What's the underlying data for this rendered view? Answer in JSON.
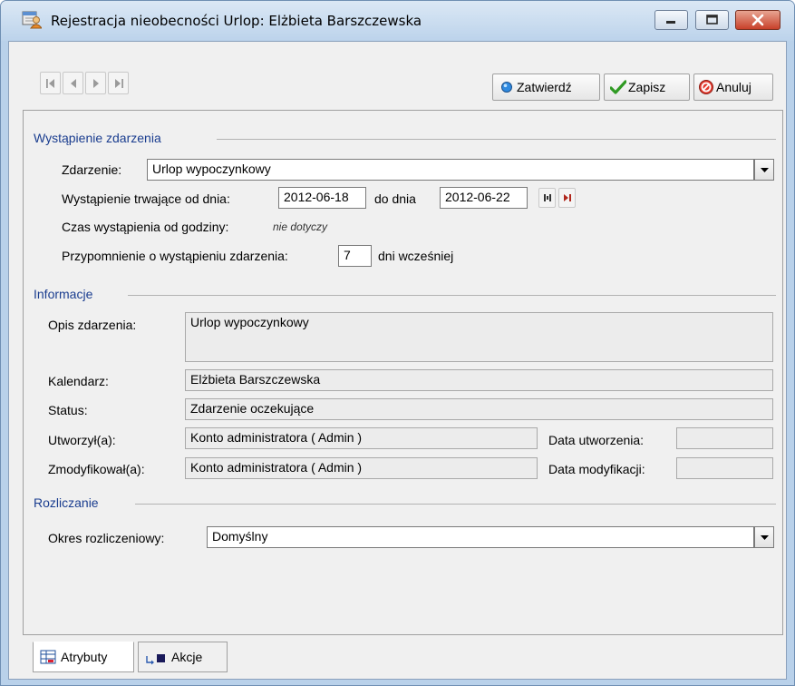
{
  "window": {
    "title": "Rejestracja nieobecności Urlop:  Elżbieta Barszczewska",
    "minimize_icon": "minimize-icon",
    "maximize_icon": "maximize-icon",
    "close_icon": "close-icon"
  },
  "toolbar": {
    "nav_icons": [
      "first-record-icon",
      "previous-record-icon",
      "next-record-icon",
      "last-record-icon"
    ],
    "approve_label": "Zatwierdź",
    "save_label": "Zapisz",
    "cancel_label": "Anuluj"
  },
  "occurrence": {
    "section_title": "Wystąpienie zdarzenia",
    "event_label": "Zdarzenie:",
    "event_value": "Urlop wypoczynkowy",
    "from_label": "Wystąpienie trwające od dnia:",
    "from_value": "2012-06-18",
    "to_label": "do dnia",
    "to_value": "2012-06-22",
    "time_label": "Czas wystąpienia od godziny:",
    "time_value": "nie dotyczy",
    "reminder_label": "Przypomnienie o wystąpieniu zdarzenia:",
    "reminder_value": "7",
    "reminder_suffix": "dni wcześniej"
  },
  "info": {
    "section_title": "Informacje",
    "desc_label": "Opis zdarzenia:",
    "desc_value": "Urlop wypoczynkowy",
    "calendar_label": "Kalendarz:",
    "calendar_value": "Elżbieta Barszczewska",
    "status_label": "Status:",
    "status_value": "Zdarzenie oczekujące",
    "created_by_label": "Utworzył(a):",
    "created_by_value": "Konto administratora ( Admin )",
    "created_date_label": "Data utworzenia:",
    "created_date_value": "",
    "modified_by_label": "Zmodyfikował(a):",
    "modified_by_value": "Konto administratora ( Admin )",
    "modified_date_label": "Data modyfikacji:",
    "modified_date_value": ""
  },
  "settlement": {
    "section_title": "Rozliczanie",
    "period_label": "Okres rozliczeniowy:",
    "period_value": "Domyślny"
  },
  "tabs": {
    "attributes_label": "Atrybuty",
    "actions_label": "Akcje"
  },
  "colors": {
    "title_bar": "#c4d8ee",
    "section_title": "#1a3d8f",
    "close_button": "#c8412a"
  }
}
